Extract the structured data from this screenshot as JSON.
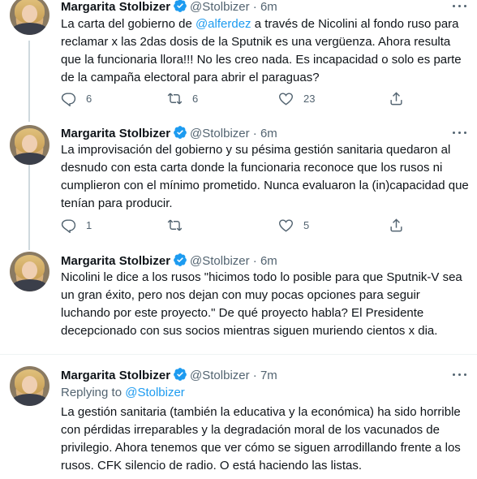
{
  "colors": {
    "accent": "#1d9bf0",
    "muted": "#536471",
    "text": "#0f1419",
    "divider": "#eff3f4"
  },
  "icons": [
    "verified-badge-icon",
    "more-options-icon",
    "reply-icon",
    "retweet-icon",
    "like-icon",
    "share-icon"
  ],
  "tweets": [
    {
      "name": "Margarita Stolbizer",
      "handle": "@Stolbizer",
      "dot": "·",
      "time": "6m",
      "body_before": "La carta del gobierno de ",
      "mention": "@alferdez",
      "body_after": " a través de Nicolini al fondo ruso para reclamar x las 2das dosis de la Sputnik es una vergüenza. Ahora resulta que la funcionaria llora!!! No les creo nada. Es incapacidad o solo es parte de la campaña electoral para abrir el paraguas?",
      "replies": "6",
      "retweets": "6",
      "likes": "23"
    },
    {
      "name": "Margarita Stolbizer",
      "handle": "@Stolbizer",
      "dot": "·",
      "time": "6m",
      "body": "La improvisación del gobierno y su pésima gestión sanitaria quedaron al desnudo con esta carta donde la funcionaria reconoce que los rusos ni cumplieron con el mínimo prometido. Nunca evaluaron la (in)capacidad que tenían para producir.",
      "replies": "1",
      "retweets": "",
      "likes": "5"
    },
    {
      "name": "Margarita Stolbizer",
      "handle": "@Stolbizer",
      "dot": "·",
      "time": "6m",
      "body": "Nicolini le dice a los rusos \"hicimos todo lo posible para que Sputnik-V sea un gran éxito, pero nos dejan con muy pocas opciones para seguir luchando por este proyecto.\" De qué proyecto habla? El Presidente decepcionado con sus socios mientras siguen muriendo cientos x dia."
    },
    {
      "name": "Margarita Stolbizer",
      "handle": "@Stolbizer",
      "dot": "·",
      "time": "7m",
      "replying_label": "Replying to ",
      "replying_to": "@Stolbizer",
      "body": "La gestión sanitaria (también la educativa y la económica) ha sido horrible con pérdidas irreparables y la degradación moral de los vacunados de privilegio. Ahora tenemos que ver cómo se siguen arrodillando frente a los rusos. CFK silencio de radio. O está haciendo las listas."
    }
  ]
}
